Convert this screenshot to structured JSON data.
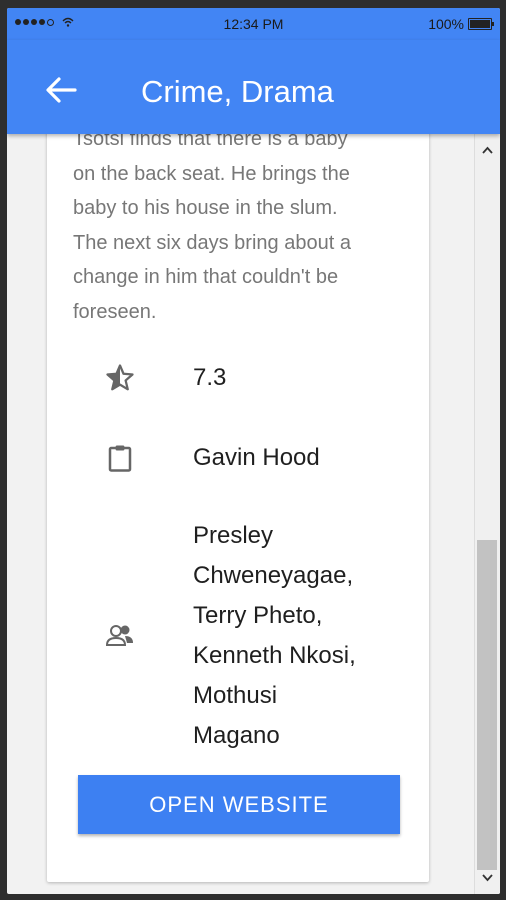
{
  "status_bar": {
    "time": "12:34 PM",
    "battery": "100%"
  },
  "app_bar": {
    "title": "Crime, Drama",
    "back_icon": "arrow-left-icon"
  },
  "movie": {
    "description_lines": [
      "Tsotsi finds that there is a baby",
      "on the back seat. He brings the",
      "baby to his house in the slum.",
      "The next six days bring about a",
      "change in him that couldn't be",
      "foreseen."
    ],
    "rating": {
      "icon": "star-half-icon",
      "value": "7.3"
    },
    "director": {
      "icon": "clipboard-icon",
      "value": "Gavin Hood"
    },
    "cast": {
      "icon": "people-icon",
      "lines": [
        "Presley",
        "Chweneyagae,",
        "Terry Pheto,",
        "Kenneth Nkosi,",
        "Mothusi",
        "Magano"
      ]
    }
  },
  "actions": {
    "open_website": "OPEN WEBSITE"
  },
  "colors": {
    "primary": "#4285f4",
    "button": "#3d80f2",
    "text_secondary": "#777777"
  }
}
